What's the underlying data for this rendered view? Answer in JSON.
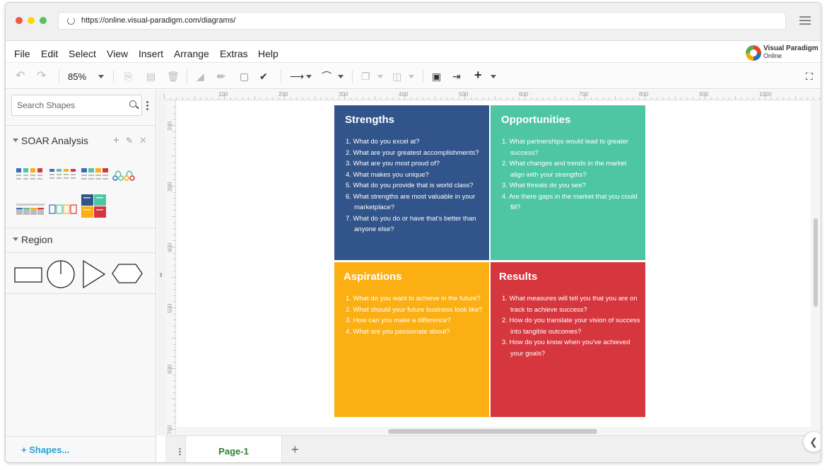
{
  "browser": {
    "url": "https://online.visual-paradigm.com/diagrams/"
  },
  "menu": [
    "File",
    "Edit",
    "Select",
    "View",
    "Insert",
    "Arrange",
    "Extras",
    "Help"
  ],
  "logo": {
    "line1": "Visual Paradigm",
    "line2": "Online"
  },
  "toolbar": {
    "zoom": "85%"
  },
  "left_panel": {
    "search_placeholder": "Search Shapes",
    "sections": [
      {
        "title": "SOAR Analysis"
      },
      {
        "title": "Region"
      }
    ],
    "more_shapes": "+ Shapes..."
  },
  "rulers": {
    "top": [
      "100",
      "200",
      "300",
      "400",
      "500",
      "600",
      "700",
      "800",
      "900",
      "1000"
    ],
    "left": [
      "200",
      "300",
      "400",
      "500",
      "600",
      "700"
    ]
  },
  "diagram": {
    "quadrants": [
      {
        "title": "Strengths",
        "color": "#31548b",
        "items": [
          "1. What do you excel at?",
          "2. What are your greatest accomplishments?",
          "3. What are you most proud of?",
          "4. What makes you unique?",
          "5. What do you provide that is world class?",
          "6. What strengths are most valuable in your marketplace?",
          "7. What do you do or have that's better than anyone else?"
        ]
      },
      {
        "title": "Opportunities",
        "color": "#4ec6a5",
        "items": [
          "1. What partnerships would lead to greater success?",
          "2. What changes and trends in the market align with your strengths?",
          "3. What threats do you see?",
          "4. Are there gaps in the market that you could fill?"
        ]
      },
      {
        "title": "Aspirations",
        "color": "#fbaf13",
        "items": [
          "1. What do you want to achieve in the future?",
          "2. What should your future business look like?",
          "3. How can you make a difference?",
          "4. What are you passionate about?"
        ]
      },
      {
        "title": "Results",
        "color": "#d6363e",
        "items": [
          "1. What measures will tell you that you are on track to achieve success?",
          "2. How do you translate your vision of success into tangible outcomes?",
          "3. How do you know when you've achieved your goals?"
        ]
      }
    ]
  },
  "pages": {
    "current": "Page-1"
  }
}
